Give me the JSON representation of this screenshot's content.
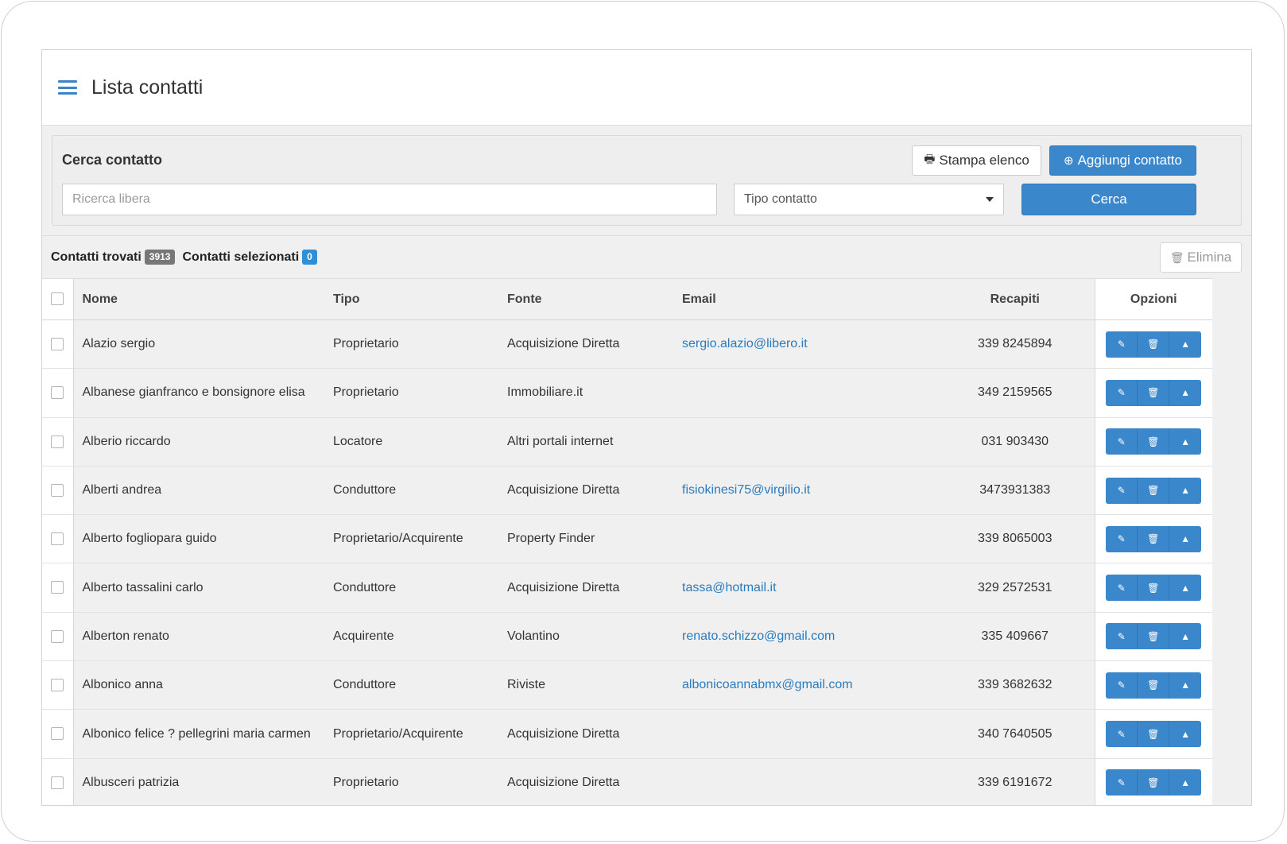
{
  "header": {
    "title": "Lista contatti"
  },
  "search": {
    "title": "Cerca contatto",
    "print_label": "Stampa elenco",
    "add_label": "Aggiungi contatto",
    "free_search_placeholder": "Ricerca libera",
    "type_select_value": "Tipo contatto",
    "search_button": "Cerca"
  },
  "results": {
    "found_label": "Contatti trovati",
    "found_count": "3913",
    "selected_label": "Contatti selezionati",
    "selected_count": "0",
    "delete_label": "Elimina"
  },
  "table": {
    "columns": {
      "name": "Nome",
      "tipo": "Tipo",
      "fonte": "Fonte",
      "email": "Email",
      "recapiti": "Recapiti",
      "opzioni": "Opzioni"
    },
    "rows": [
      {
        "name": "Alazio sergio",
        "tipo": "Proprietario",
        "fonte": "Acquisizione Diretta",
        "email": "sergio.alazio@libero.it",
        "recapiti": "339 8245894"
      },
      {
        "name": "Albanese gianfranco e bonsignore elisa",
        "tipo": "Proprietario",
        "fonte": "Immobiliare.it",
        "email": "",
        "recapiti": "349 2159565"
      },
      {
        "name": "Alberio riccardo",
        "tipo": "Locatore",
        "fonte": "Altri portali internet",
        "email": "",
        "recapiti": "031 903430"
      },
      {
        "name": "Alberti andrea",
        "tipo": "Conduttore",
        "fonte": "Acquisizione Diretta",
        "email": "fisiokinesi75@virgilio.it",
        "recapiti": "3473931383"
      },
      {
        "name": "Alberto fogliopara guido",
        "tipo": "Proprietario/Acquirente",
        "fonte": "Property Finder",
        "email": "",
        "recapiti": "339 8065003"
      },
      {
        "name": "Alberto tassalini carlo",
        "tipo": "Conduttore",
        "fonte": "Acquisizione Diretta",
        "email": "tassa@hotmail.it",
        "recapiti": "329 2572531"
      },
      {
        "name": "Alberton renato",
        "tipo": "Acquirente",
        "fonte": "Volantino",
        "email": "renato.schizzo@gmail.com",
        "recapiti": "335 409667"
      },
      {
        "name": "Albonico anna",
        "tipo": "Conduttore",
        "fonte": "Riviste",
        "email": "albonicoannabmx@gmail.com",
        "recapiti": "339 3682632"
      },
      {
        "name": "Albonico felice ? pellegrini maria carmen",
        "tipo": "Proprietario/Acquirente",
        "fonte": "Acquisizione Diretta",
        "email": "",
        "recapiti": "340 7640505"
      },
      {
        "name": "Albusceri patrizia",
        "tipo": "Proprietario",
        "fonte": "Acquisizione Diretta",
        "email": "",
        "recapiti": "339 6191672"
      }
    ]
  },
  "icons": {
    "menu": "hamburger-menu-icon",
    "print": "printer-icon",
    "add": "plus-circle-icon",
    "trash": "trash-icon",
    "edit": "pencil-icon",
    "caret_up": "caret-up-icon"
  },
  "colors": {
    "accent": "#3a87cc",
    "link": "#2a7bbd",
    "badge_gray": "#777777",
    "badge_blue": "#2f8fd6"
  }
}
